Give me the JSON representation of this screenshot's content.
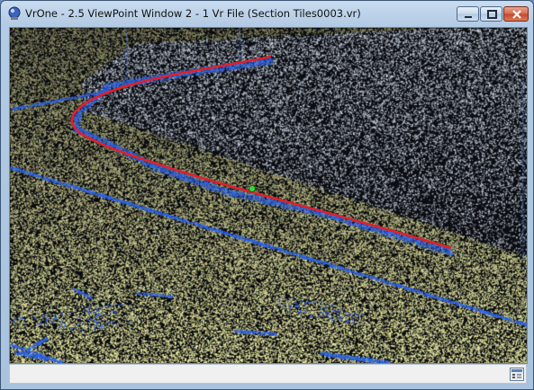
{
  "window": {
    "title": "VrOne - 2.5 ViewPoint Window 2 - 1 Vr File (Section Tiles0003.vr)"
  },
  "controls": {
    "minimize": "minimize-icon",
    "maximize": "maximize-icon",
    "close": "close-icon"
  },
  "colors": {
    "road_lidar": "#f2f2a6",
    "dark_lidar": "#111418",
    "lane_marking": "#1f5fe0",
    "breakline": "#e0202a",
    "vertex": "#3ad83a"
  },
  "statusbar": {
    "icon": "settings-panel-icon"
  }
}
